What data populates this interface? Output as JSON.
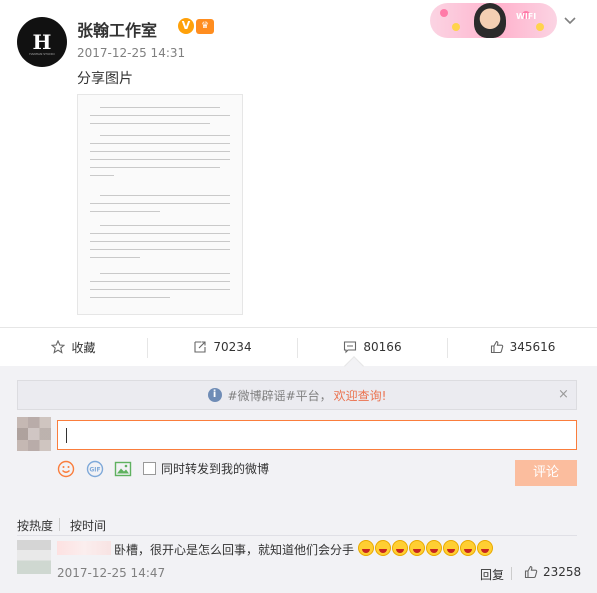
{
  "post": {
    "author": "张翰工作室",
    "avatar_mark": "H",
    "avatar_sub": "HANHAN STUDIO",
    "time": "2017-12-25 14:31",
    "text": "分享图片",
    "banner": "WIFI"
  },
  "actions": {
    "favorite_label": "收藏",
    "forward_count": "70234",
    "comment_count": "80166",
    "like_count": "345616"
  },
  "notice": {
    "prefix": "#微博辟谣#平台，",
    "link": "欢迎查询!",
    "close": "×"
  },
  "composer": {
    "forward_label": "同时转发到我的微博",
    "submit_label": "评论"
  },
  "sort": {
    "hot": "按热度",
    "time": "按时间"
  },
  "comment": {
    "text": "卧槽，很开心是怎么回事，就知道他们会分手",
    "emoji_count": 8,
    "time": "2017-12-25 14:47",
    "reply_label": "回复",
    "likes": "23258"
  },
  "colors": {
    "accent": "#fa7d3c",
    "link": "#eb7350",
    "submit_disabled": "#fbbd9e"
  }
}
